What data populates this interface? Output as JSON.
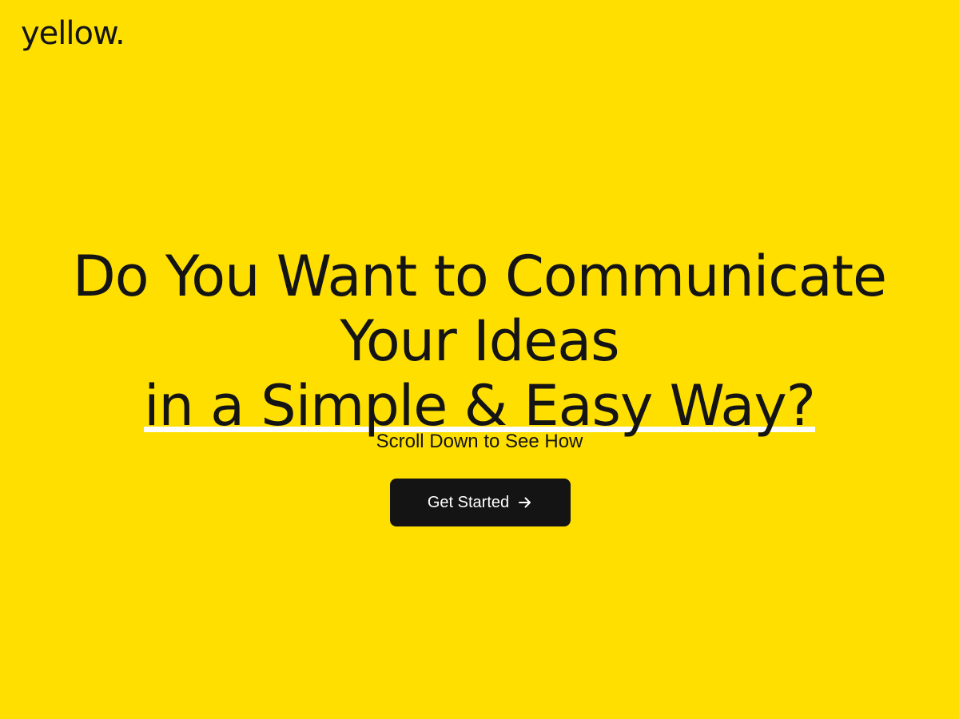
{
  "brand": {
    "logo_text": "yellow."
  },
  "hero": {
    "headline_line1": "Do You Want to Communicate",
    "headline_line2": "Your Ideas",
    "headline_line3": "in a Simple & Easy Way?",
    "subtext": "Scroll Down to See How",
    "cta_label": "Get Started",
    "cta_icon": "arrow-right-icon"
  },
  "colors": {
    "background": "#FFDF00",
    "text": "#141414",
    "button_bg": "#141414",
    "button_text": "#FFFFFF",
    "underline": "#FFFFFF"
  }
}
